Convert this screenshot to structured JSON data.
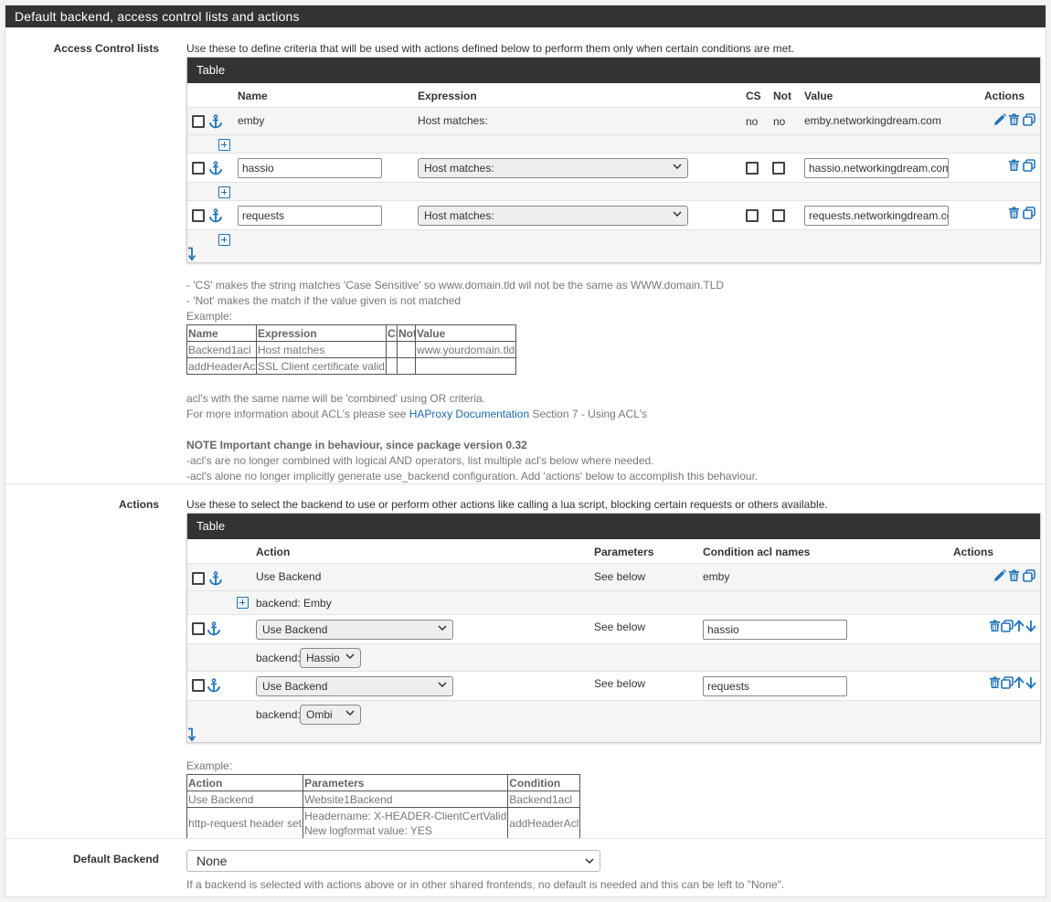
{
  "panel": {
    "title": "Default backend, access control lists and actions"
  },
  "acl": {
    "label": "Access Control lists",
    "help": "Use these to define criteria that will be used with actions defined below to perform them only when certain conditions are met.",
    "table_title": "Table",
    "headers": {
      "name": "Name",
      "expression": "Expression",
      "cs": "CS",
      "not": "Not",
      "value": "Value",
      "actions": "Actions"
    },
    "rows": [
      {
        "name": "emby",
        "expression": "Host matches:",
        "cs": "no",
        "not": "no",
        "value": "emby.networkingdream.com"
      },
      {
        "name": "hassio",
        "expression": "Host matches:",
        "value": "hassio.networkingdream.com"
      },
      {
        "name": "requests",
        "expression": "Host matches:",
        "value": "requests.networkingdream.com"
      }
    ],
    "notes": [
      "- 'CS' makes the string matches 'Case Sensitive' so www.domain.tld wil not be the same as WWW.domain.TLD",
      "- 'Not' makes the match if the value given is not matched",
      "Example:"
    ],
    "example": {
      "headers": [
        "Name",
        "Expression",
        "CS",
        "Not",
        "Value"
      ],
      "rows": [
        [
          "Backend1acl",
          "Host matches",
          "",
          "",
          "www.yourdomain.tld"
        ],
        [
          "addHeaderAcl",
          "SSL Client certificate valid",
          "",
          "",
          ""
        ]
      ]
    },
    "combined_note": "acl's with the same name will be 'combined' using OR criteria.",
    "more_info_prefix": "For more information about ACL's please see ",
    "more_info_link": "HAProxy Documentation",
    "more_info_suffix": " Section 7 - Using ACL's",
    "important_title": "NOTE Important change in behaviour, since package version 0.32",
    "important_1": "-acl's are no longer combined with logical AND operators, list multiple acl's below where needed.",
    "important_2": "-acl's alone no longer implicitly generate use_backend configuration. Add 'actions' below to accomplish this behaviour."
  },
  "actions": {
    "label": "Actions",
    "help": "Use these to select the backend to use or perform other actions like calling a lua script, blocking certain requests or others available.",
    "table_title": "Table",
    "headers": {
      "action": "Action",
      "parameters": "Parameters",
      "condition": "Condition acl names",
      "actions": "Actions"
    },
    "rows": [
      {
        "action": "Use Backend",
        "parameters": "See below",
        "condition": "emby",
        "sub_label": "backend: Emby"
      },
      {
        "action": "Use Backend",
        "parameters": "See below",
        "condition": "hassio",
        "sub_label": "backend:",
        "backend": "Hassio"
      },
      {
        "action": "Use Backend",
        "parameters": "See below",
        "condition": "requests",
        "sub_label": "backend:",
        "backend": "Ombi"
      }
    ],
    "example_label": "Example:",
    "example": {
      "headers": [
        "Action",
        "Parameters",
        "Condition"
      ],
      "row1": [
        "Use Backend",
        "Website1Backend",
        "Backend1acl"
      ],
      "row2_action": "http-request header set",
      "row2_param_line1": "Headername: X-HEADER-ClientCertValid",
      "row2_param_line2": "New logformat value: YES",
      "row2_condition": "addHeaderAcl"
    }
  },
  "default_backend": {
    "label": "Default Backend",
    "value": "None",
    "help": "If a backend is selected with actions above or in other shared frontends, no default is needed and this can be left to \"None\"."
  }
}
